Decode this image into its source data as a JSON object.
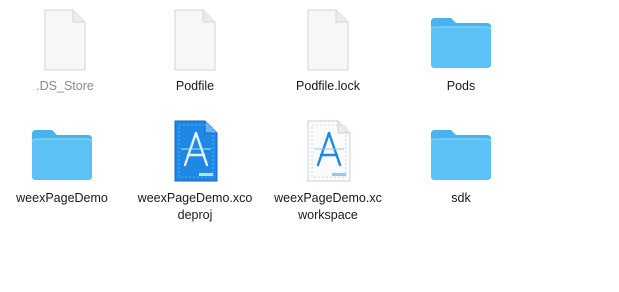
{
  "window": {
    "view_mode": "icon-view"
  },
  "items": [
    {
      "name": ".DS_Store",
      "name_lines": [
        ".DS_Store"
      ],
      "kind": "document",
      "icon": "blank-document-icon",
      "hidden": true
    },
    {
      "name": "Podfile",
      "name_lines": [
        "Podfile"
      ],
      "kind": "document",
      "icon": "blank-document-icon",
      "hidden": false
    },
    {
      "name": "Podfile.lock",
      "name_lines": [
        "Podfile.lock"
      ],
      "kind": "document",
      "icon": "blank-document-icon",
      "hidden": false
    },
    {
      "name": "Pods",
      "name_lines": [
        "Pods"
      ],
      "kind": "folder",
      "icon": "folder-icon",
      "hidden": false
    },
    {
      "name": "weexPageDemo",
      "name_lines": [
        "weexPageDemo"
      ],
      "kind": "folder",
      "icon": "folder-icon",
      "hidden": false
    },
    {
      "name": "weexPageDemo.xcodeproj",
      "name_lines": [
        "weexPageDemo.xco",
        "deproj"
      ],
      "kind": "xcode-project",
      "icon": "xcode-project-icon",
      "hidden": false
    },
    {
      "name": "weexPageDemo.xcworkspace",
      "name_lines": [
        "weexPageDemo.xc",
        "workspace"
      ],
      "kind": "xcode-workspace",
      "icon": "xcode-workspace-icon",
      "hidden": false
    },
    {
      "name": "sdk",
      "name_lines": [
        "sdk"
      ],
      "kind": "folder",
      "icon": "folder-icon",
      "hidden": false
    }
  ],
  "colors": {
    "folder_front": "#5cc1f5",
    "folder_tab": "#49b3ec",
    "document_page": "#f7f7f7",
    "document_border": "#d6d6d6",
    "xcode_blue": "#1e88e5",
    "hidden_label": "#8a8a8a"
  }
}
